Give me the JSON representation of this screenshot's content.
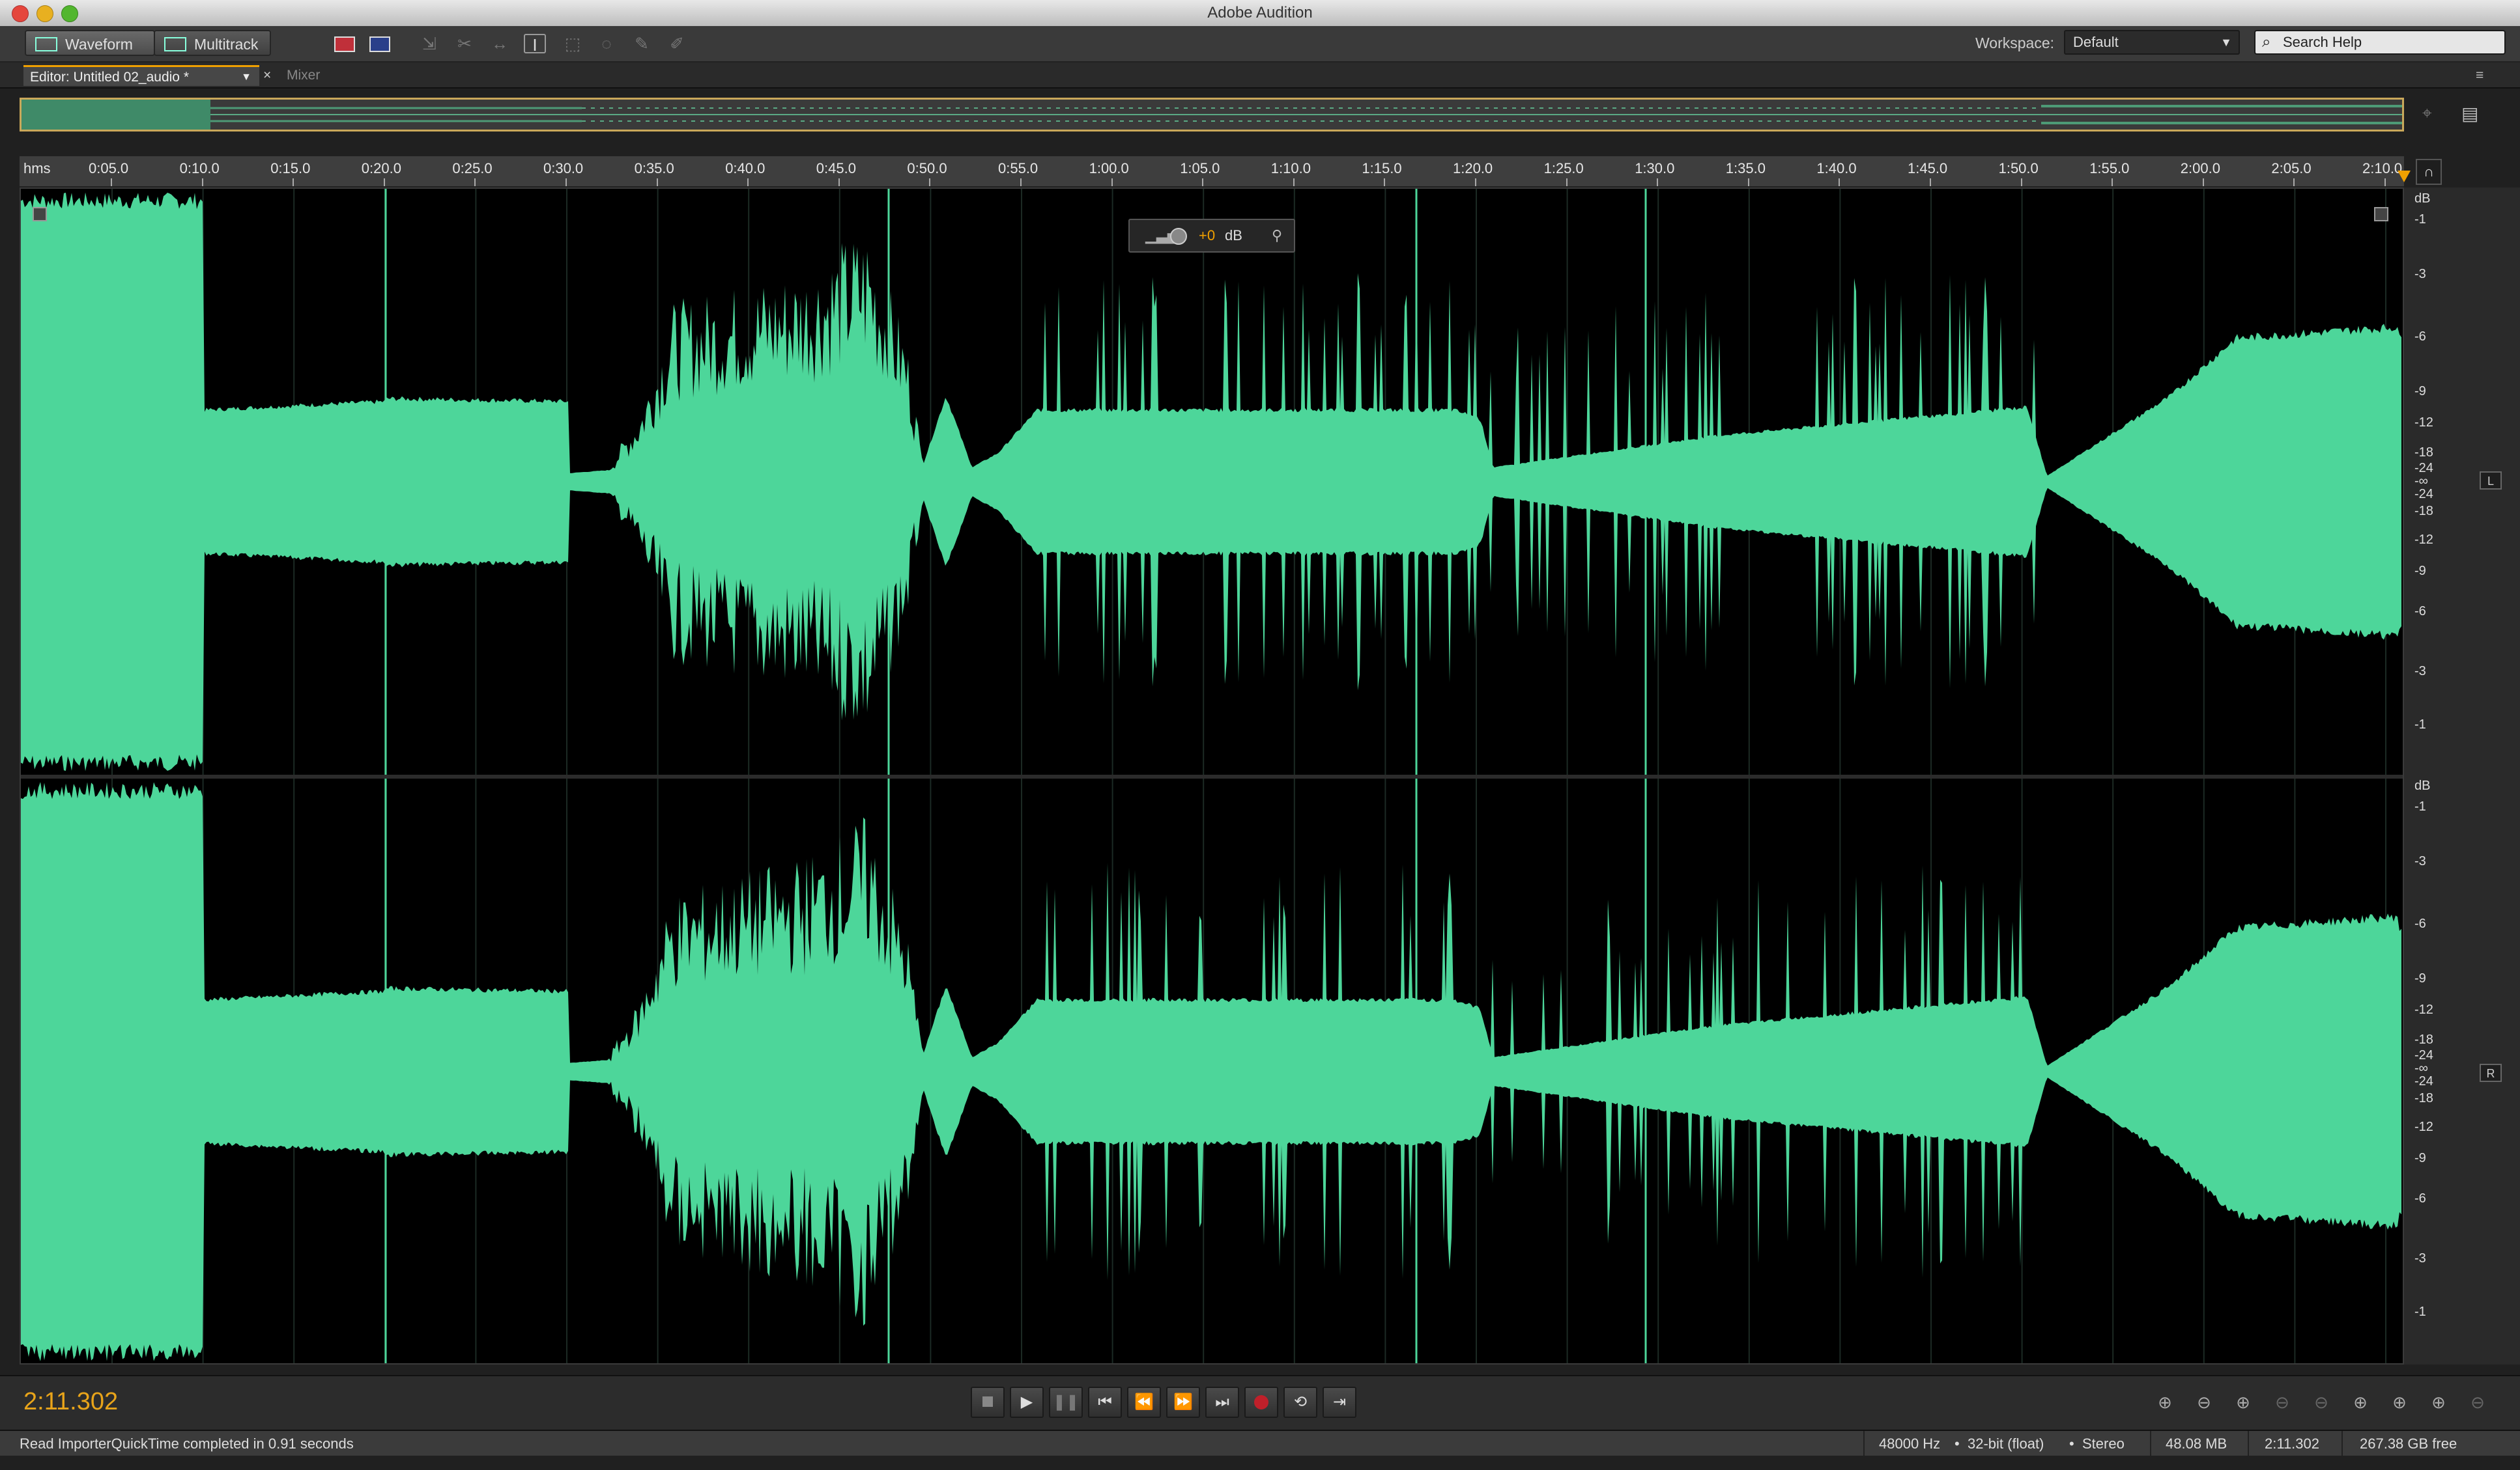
{
  "app": {
    "window_title": "Adobe Audition"
  },
  "toolbar": {
    "waveform_label": "Waveform",
    "multitrack_label": "Multitrack",
    "workspace_label": "Workspace:",
    "workspace_value": "Default",
    "search_placeholder": "Search Help"
  },
  "tabs": {
    "editor_label": "Editor: Untitled 02_audio *",
    "mixer_label": "Mixer"
  },
  "ruler": {
    "unit_label": "hms",
    "ticks": [
      "0:05.0",
      "0:10.0",
      "0:15.0",
      "0:20.0",
      "0:25.0",
      "0:30.0",
      "0:35.0",
      "0:40.0",
      "0:45.0",
      "0:50.0",
      "0:55.0",
      "1:00.0",
      "1:05.0",
      "1:10.0",
      "1:15.0",
      "1:20.0",
      "1:25.0",
      "1:30.0",
      "1:35.0",
      "1:40.0",
      "1:45.0",
      "1:50.0",
      "1:55.0",
      "2:00.0",
      "2:05.0",
      "2:10.0"
    ]
  },
  "hud": {
    "gain_value": "+0",
    "gain_unit": "dB"
  },
  "db_scale": {
    "unit": "dB",
    "labels": [
      "-1",
      "-3",
      "-6",
      "-9",
      "-12",
      "-18",
      "-24",
      "-∞",
      "-24",
      "-18",
      "-12",
      "-9",
      "-6",
      "-3",
      "-1"
    ],
    "left_channel": "L",
    "right_channel": "R"
  },
  "waveform": {
    "color": "#4dd69a",
    "background": "#000000"
  },
  "transport": {
    "current_time": "2:11.302"
  },
  "status": {
    "message": "Read ImporterQuickTime completed in 0.91 seconds",
    "sample_rate": "48000 Hz",
    "bit_depth": "32-bit (float)",
    "channels": "Stereo",
    "memory": "48.08 MB",
    "duration": "2:11.302",
    "free_space": "267.38 GB free"
  }
}
